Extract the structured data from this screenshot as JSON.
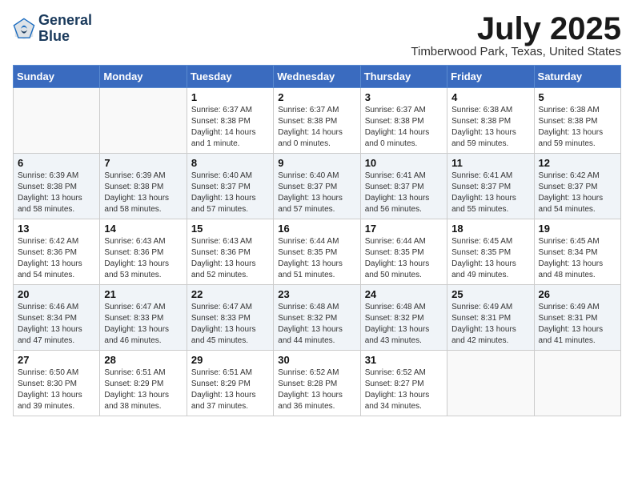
{
  "logo": {
    "line1": "General",
    "line2": "Blue"
  },
  "title": "July 2025",
  "location": "Timberwood Park, Texas, United States",
  "headers": [
    "Sunday",
    "Monday",
    "Tuesday",
    "Wednesday",
    "Thursday",
    "Friday",
    "Saturday"
  ],
  "weeks": [
    [
      {
        "day": "",
        "info": ""
      },
      {
        "day": "",
        "info": ""
      },
      {
        "day": "1",
        "info": "Sunrise: 6:37 AM\nSunset: 8:38 PM\nDaylight: 14 hours\nand 1 minute."
      },
      {
        "day": "2",
        "info": "Sunrise: 6:37 AM\nSunset: 8:38 PM\nDaylight: 14 hours\nand 0 minutes."
      },
      {
        "day": "3",
        "info": "Sunrise: 6:37 AM\nSunset: 8:38 PM\nDaylight: 14 hours\nand 0 minutes."
      },
      {
        "day": "4",
        "info": "Sunrise: 6:38 AM\nSunset: 8:38 PM\nDaylight: 13 hours\nand 59 minutes."
      },
      {
        "day": "5",
        "info": "Sunrise: 6:38 AM\nSunset: 8:38 PM\nDaylight: 13 hours\nand 59 minutes."
      }
    ],
    [
      {
        "day": "6",
        "info": "Sunrise: 6:39 AM\nSunset: 8:38 PM\nDaylight: 13 hours\nand 58 minutes."
      },
      {
        "day": "7",
        "info": "Sunrise: 6:39 AM\nSunset: 8:38 PM\nDaylight: 13 hours\nand 58 minutes."
      },
      {
        "day": "8",
        "info": "Sunrise: 6:40 AM\nSunset: 8:37 PM\nDaylight: 13 hours\nand 57 minutes."
      },
      {
        "day": "9",
        "info": "Sunrise: 6:40 AM\nSunset: 8:37 PM\nDaylight: 13 hours\nand 57 minutes."
      },
      {
        "day": "10",
        "info": "Sunrise: 6:41 AM\nSunset: 8:37 PM\nDaylight: 13 hours\nand 56 minutes."
      },
      {
        "day": "11",
        "info": "Sunrise: 6:41 AM\nSunset: 8:37 PM\nDaylight: 13 hours\nand 55 minutes."
      },
      {
        "day": "12",
        "info": "Sunrise: 6:42 AM\nSunset: 8:37 PM\nDaylight: 13 hours\nand 54 minutes."
      }
    ],
    [
      {
        "day": "13",
        "info": "Sunrise: 6:42 AM\nSunset: 8:36 PM\nDaylight: 13 hours\nand 54 minutes."
      },
      {
        "day": "14",
        "info": "Sunrise: 6:43 AM\nSunset: 8:36 PM\nDaylight: 13 hours\nand 53 minutes."
      },
      {
        "day": "15",
        "info": "Sunrise: 6:43 AM\nSunset: 8:36 PM\nDaylight: 13 hours\nand 52 minutes."
      },
      {
        "day": "16",
        "info": "Sunrise: 6:44 AM\nSunset: 8:35 PM\nDaylight: 13 hours\nand 51 minutes."
      },
      {
        "day": "17",
        "info": "Sunrise: 6:44 AM\nSunset: 8:35 PM\nDaylight: 13 hours\nand 50 minutes."
      },
      {
        "day": "18",
        "info": "Sunrise: 6:45 AM\nSunset: 8:35 PM\nDaylight: 13 hours\nand 49 minutes."
      },
      {
        "day": "19",
        "info": "Sunrise: 6:45 AM\nSunset: 8:34 PM\nDaylight: 13 hours\nand 48 minutes."
      }
    ],
    [
      {
        "day": "20",
        "info": "Sunrise: 6:46 AM\nSunset: 8:34 PM\nDaylight: 13 hours\nand 47 minutes."
      },
      {
        "day": "21",
        "info": "Sunrise: 6:47 AM\nSunset: 8:33 PM\nDaylight: 13 hours\nand 46 minutes."
      },
      {
        "day": "22",
        "info": "Sunrise: 6:47 AM\nSunset: 8:33 PM\nDaylight: 13 hours\nand 45 minutes."
      },
      {
        "day": "23",
        "info": "Sunrise: 6:48 AM\nSunset: 8:32 PM\nDaylight: 13 hours\nand 44 minutes."
      },
      {
        "day": "24",
        "info": "Sunrise: 6:48 AM\nSunset: 8:32 PM\nDaylight: 13 hours\nand 43 minutes."
      },
      {
        "day": "25",
        "info": "Sunrise: 6:49 AM\nSunset: 8:31 PM\nDaylight: 13 hours\nand 42 minutes."
      },
      {
        "day": "26",
        "info": "Sunrise: 6:49 AM\nSunset: 8:31 PM\nDaylight: 13 hours\nand 41 minutes."
      }
    ],
    [
      {
        "day": "27",
        "info": "Sunrise: 6:50 AM\nSunset: 8:30 PM\nDaylight: 13 hours\nand 39 minutes."
      },
      {
        "day": "28",
        "info": "Sunrise: 6:51 AM\nSunset: 8:29 PM\nDaylight: 13 hours\nand 38 minutes."
      },
      {
        "day": "29",
        "info": "Sunrise: 6:51 AM\nSunset: 8:29 PM\nDaylight: 13 hours\nand 37 minutes."
      },
      {
        "day": "30",
        "info": "Sunrise: 6:52 AM\nSunset: 8:28 PM\nDaylight: 13 hours\nand 36 minutes."
      },
      {
        "day": "31",
        "info": "Sunrise: 6:52 AM\nSunset: 8:27 PM\nDaylight: 13 hours\nand 34 minutes."
      },
      {
        "day": "",
        "info": ""
      },
      {
        "day": "",
        "info": ""
      }
    ]
  ]
}
